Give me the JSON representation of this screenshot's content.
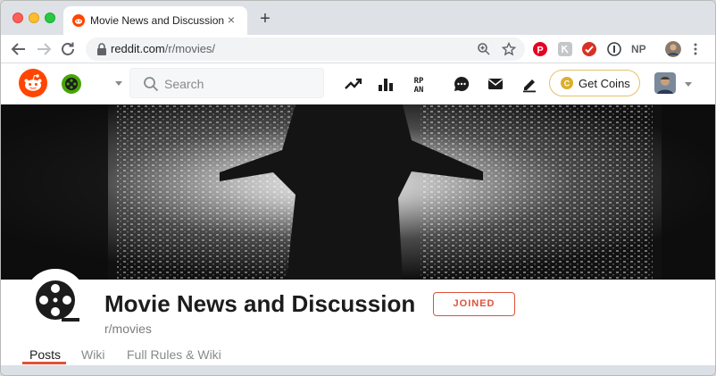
{
  "browser": {
    "tab_title": "Movie News and Discussion",
    "tab_close": "×",
    "new_tab": "+",
    "url_domain": "reddit.com",
    "url_path": "/r/movies/",
    "extensions": [
      {
        "name": "pinterest-icon",
        "color": "#e60023"
      },
      {
        "name": "extension-icon-gray",
        "color": "#9aa0a6"
      },
      {
        "name": "checkmark-icon",
        "color": "#d93025"
      },
      {
        "name": "1password-icon",
        "color": "#3c4043"
      }
    ],
    "np_label": "NP"
  },
  "reddit": {
    "search_placeholder": "Search",
    "get_coins_label": "Get Coins",
    "brand_color": "#ff4500",
    "joined_color": "#e0523a"
  },
  "community": {
    "title": "Movie News and Discussion",
    "subreddit": "r/movies",
    "joined_label": "JOINED",
    "tabs": [
      {
        "label": "Posts",
        "active": true
      },
      {
        "label": "Wiki",
        "active": false
      },
      {
        "label": "Full Rules & Wiki",
        "active": false
      }
    ]
  }
}
